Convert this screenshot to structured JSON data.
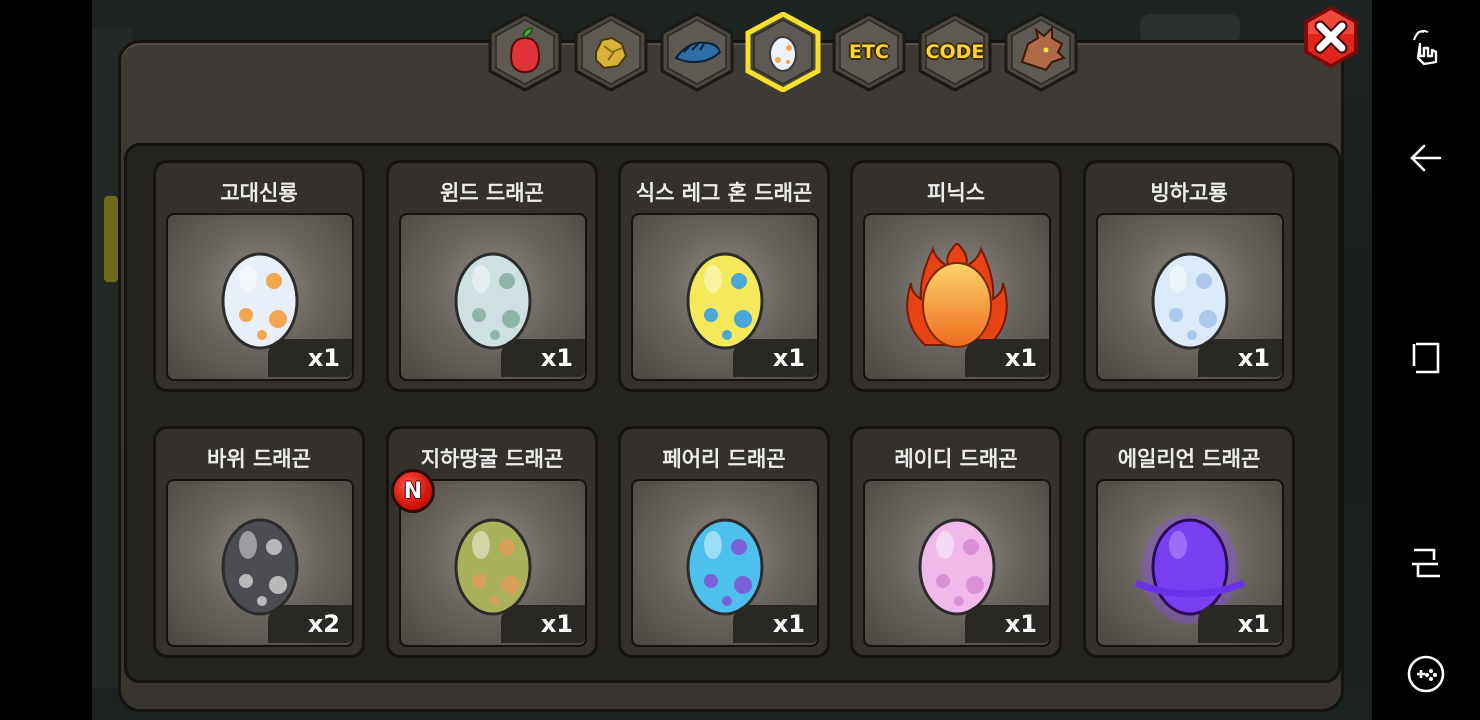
{
  "tabs": [
    {
      "id": "fruit",
      "icon": "fruit-icon",
      "label": ""
    },
    {
      "id": "ore",
      "icon": "ore-icon",
      "label": ""
    },
    {
      "id": "fish",
      "icon": "fish-icon",
      "label": ""
    },
    {
      "id": "egg",
      "icon": "egg-icon",
      "label": "",
      "selected": true
    },
    {
      "id": "etc",
      "icon": "",
      "label": "ETC"
    },
    {
      "id": "code",
      "icon": "",
      "label": "CODE"
    },
    {
      "id": "dragon",
      "icon": "dragon-head-icon",
      "label": ""
    }
  ],
  "close_icon": "close-icon",
  "items": [
    {
      "name": "고대신룡",
      "qty": "x1",
      "egg": "ancient",
      "colors": [
        "#e9eff8",
        "#f0a850"
      ]
    },
    {
      "name": "윈드 드래곤",
      "qty": "x1",
      "egg": "wind",
      "colors": [
        "#cfe0e2",
        "#8fb5a8"
      ]
    },
    {
      "name": "식스 레그 혼 드래곤",
      "qty": "x1",
      "egg": "sixleg",
      "colors": [
        "#f5e85a",
        "#4aa8d8"
      ]
    },
    {
      "name": "피닉스",
      "qty": "x1",
      "egg": "phoenix",
      "colors": [
        "#f6a63a",
        "#e2471a"
      ]
    },
    {
      "name": "빙하고룡",
      "qty": "x1",
      "egg": "glacier",
      "colors": [
        "#dbe9f8",
        "#a9c8ec"
      ]
    },
    {
      "name": "바위 드래곤",
      "qty": "x2",
      "egg": "rock",
      "colors": [
        "#4b4d52",
        "#b8b8b8"
      ]
    },
    {
      "name": "지하땅굴 드래곤",
      "qty": "x1",
      "egg": "tunnel",
      "colors": [
        "#a9b25a",
        "#d9a05a"
      ],
      "new_badge": "N"
    },
    {
      "name": "페어리 드래곤",
      "qty": "x1",
      "egg": "fairy",
      "colors": [
        "#4ec0ee",
        "#7a62d8"
      ]
    },
    {
      "name": "레이디 드래곤",
      "qty": "x1",
      "egg": "lady",
      "colors": [
        "#f1b8ea",
        "#d890d6"
      ]
    },
    {
      "name": "에일리언 드래곤",
      "qty": "x1",
      "egg": "alien",
      "colors": [
        "#7a3ff0",
        "#b48cff"
      ]
    }
  ],
  "navbar": [
    {
      "icon": "gesture-icon"
    },
    {
      "icon": "back-icon"
    },
    {
      "icon": "home-icon"
    },
    {
      "icon": "recents-icon"
    },
    {
      "icon": "game-tools-icon"
    }
  ]
}
